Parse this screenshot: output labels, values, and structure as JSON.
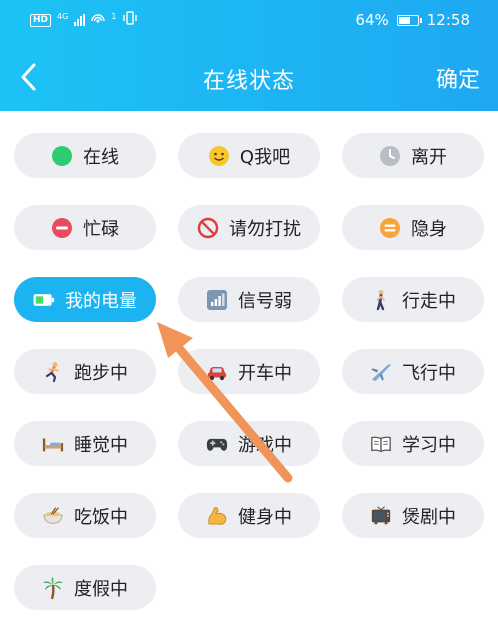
{
  "status_bar": {
    "hd_label": "HD",
    "network_label": "4G",
    "hotspot_count": "1",
    "battery_text": "64%",
    "battery_level": 0.64,
    "time": "12:58"
  },
  "header": {
    "title": "在线状态",
    "confirm_label": "确定"
  },
  "statuses": [
    {
      "label": "在线",
      "icon": "green-dot",
      "selected": false
    },
    {
      "label": "Q我吧",
      "icon": "smiley-face",
      "selected": false
    },
    {
      "label": "离开",
      "icon": "clock",
      "selected": false
    },
    {
      "label": "忙碌",
      "icon": "minus-circle",
      "selected": false
    },
    {
      "label": "请勿打扰",
      "icon": "no-entry",
      "selected": false
    },
    {
      "label": "隐身",
      "icon": "equals-circle",
      "selected": false
    },
    {
      "label": "我的电量",
      "icon": "battery",
      "selected": true
    },
    {
      "label": "信号弱",
      "icon": "signal-bars",
      "selected": false
    },
    {
      "label": "行走中",
      "icon": "walking-person",
      "selected": false
    },
    {
      "label": "跑步中",
      "icon": "running-person",
      "selected": false
    },
    {
      "label": "开车中",
      "icon": "car",
      "selected": false
    },
    {
      "label": "飞行中",
      "icon": "airplane",
      "selected": false
    },
    {
      "label": "睡觉中",
      "icon": "bed",
      "selected": false
    },
    {
      "label": "游戏中",
      "icon": "game-controller",
      "selected": false
    },
    {
      "label": "学习中",
      "icon": "open-book",
      "selected": false
    },
    {
      "label": "吃饭中",
      "icon": "noodle-bowl",
      "selected": false
    },
    {
      "label": "健身中",
      "icon": "flexed-bicep",
      "selected": false
    },
    {
      "label": "煲剧中",
      "icon": "television",
      "selected": false
    },
    {
      "label": "度假中",
      "icon": "palm-tree",
      "selected": false
    }
  ],
  "colors": {
    "header_start": "#1cc3f5",
    "header_end": "#1ea8f2",
    "selected_bg": "#1cb4f0",
    "option_bg": "#eceef1",
    "arrow": "#f0945a"
  }
}
